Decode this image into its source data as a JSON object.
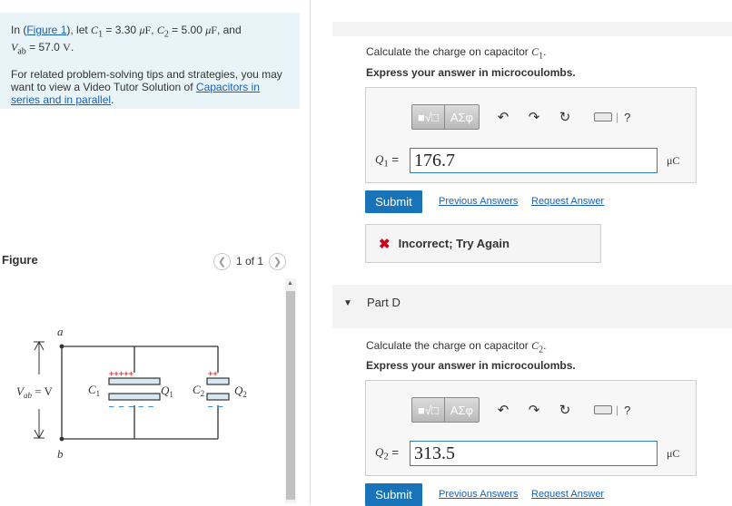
{
  "problem": {
    "line1_prefix": "In (",
    "figure_link": "Figure 1",
    "line1_mid": "), let ",
    "c1_sym": "C",
    "c1_sub": "1",
    "c1_val": " = 3.30 ",
    "mu1": "μ",
    "f1": "F",
    "sep": ", ",
    "c2_sym": "C",
    "c2_sub": "2",
    "c2_val": " = 5.00 ",
    "mu2": "μ",
    "f2": "F",
    "and": ", and",
    "vab_sym": "V",
    "vab_sub": "ab",
    "vab_val": " = 57.0 ",
    "vab_unit": "V",
    "period": ".",
    "tips_text": "For related problem-solving tips and strategies, you may want to view a Video Tutor Solution of ",
    "tips_link": "Capacitors in series and in parallel",
    "tips_end": "."
  },
  "figure": {
    "label": "Figure",
    "pager_text": "1 of 1",
    "prev_icon": "chevron-left-icon",
    "next_icon": "chevron-right-icon",
    "node_a": "a",
    "node_b": "b",
    "vab_v": "V",
    "vab_ab": "ab",
    "vab_eq": " = V",
    "c1": "C",
    "c1_sub": "1",
    "q1": "Q",
    "q1_sub": "1",
    "c2": "C",
    "c2_sub": "2",
    "q2": "Q",
    "q2_sub": "2",
    "plus_color": "#d9443a",
    "minus_color": "#3f8fd0",
    "plate_fill": "#d7e8f2"
  },
  "part_c": {
    "prompt_prefix": "Calculate the charge on capacitor ",
    "prompt_sym": "C",
    "prompt_sub": "1",
    "prompt_end": ".",
    "instruction": "Express your answer in microcoulombs.",
    "answer_label": "Q",
    "answer_label_sub": "1",
    "answer_eq": " =",
    "answer_value": "176.7",
    "unit": "μC",
    "submit": "Submit",
    "previous_answers": "Previous Answers",
    "request_answer": "Request Answer"
  },
  "feedback": {
    "icon": "x-icon",
    "text": "Incorrect; Try Again",
    "color": "#d0021b"
  },
  "part_d": {
    "title": "Part D",
    "prompt_prefix": "Calculate the charge on capacitor ",
    "prompt_sym": "C",
    "prompt_sub": "2",
    "prompt_end": ".",
    "instruction": "Express your answer in microcoulombs.",
    "answer_label": "Q",
    "answer_label_sub": "2",
    "answer_eq": " =",
    "answer_value": "313.5",
    "unit": "μC",
    "submit": "Submit",
    "previous_answers": "Previous Answers",
    "request_answer": "Request Answer"
  },
  "toolbar": {
    "templates_icon": "templates-icon",
    "greek": "ΑΣφ",
    "undo_icon": "undo-icon",
    "redo_icon": "redo-icon",
    "reset_icon": "reset-icon",
    "keyboard_icon": "keyboard-icon",
    "help": "?"
  },
  "colors": {
    "accent": "#1973b8",
    "link": "#1a5fb4",
    "problem_bg": "#e8f4f8"
  }
}
